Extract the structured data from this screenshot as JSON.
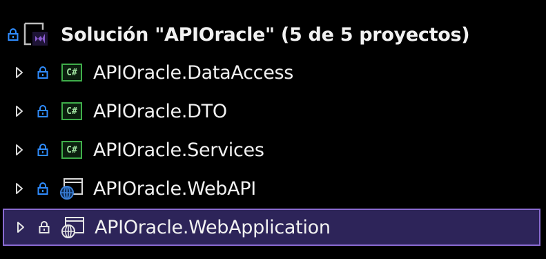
{
  "solution": {
    "title": "Solución \"APIOracle\" (5 de 5 proyectos)",
    "icon": "visual-studio-solution-icon"
  },
  "projects": [
    {
      "label": "APIOracle.DataAccess",
      "icon": "csharp-project-icon",
      "selected": false
    },
    {
      "label": "APIOracle.DTO",
      "icon": "csharp-project-icon",
      "selected": false
    },
    {
      "label": "APIOracle.Services",
      "icon": "csharp-project-icon",
      "selected": false
    },
    {
      "label": "APIOracle.WebAPI",
      "icon": "web-project-icon",
      "selected": false
    },
    {
      "label": "APIOracle.WebApplication",
      "icon": "web-project-icon",
      "selected": true
    }
  ],
  "csharp_badge": "C#",
  "colors": {
    "background": "#000000",
    "text": "#f1f1f1",
    "lock": "#2f8cff",
    "selection_background": "#2d2459",
    "selection_border": "#8a6bd1",
    "csharp_green": "#3fae4a",
    "vs_purple": "#8a5cd0",
    "web_blue": "#3a7fd6"
  }
}
